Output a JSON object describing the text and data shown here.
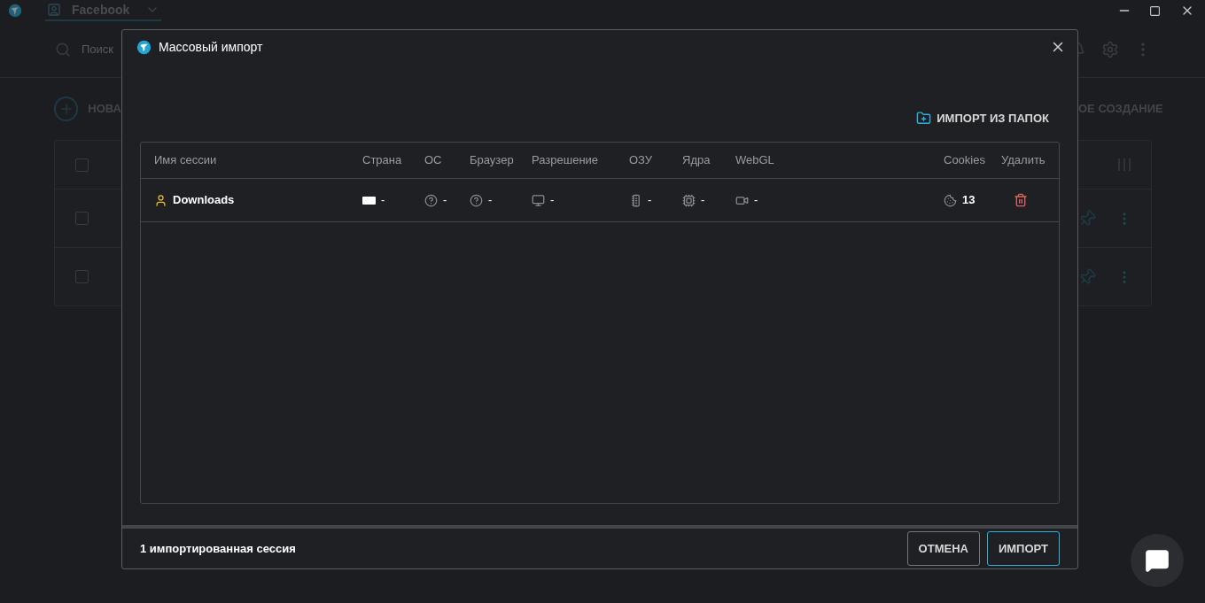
{
  "app": {
    "tab": "Facebook",
    "search_placeholder": "Поиск",
    "new_button": "НОВА",
    "bulk_button": "ОЕ СОЗДАНИЕ",
    "checkboxes": [
      {
        "checked": false
      },
      {
        "checked": false
      },
      {
        "checked": false
      }
    ]
  },
  "dialog": {
    "title": "Массовый импорт",
    "folder_import": "ИМПОРТ ИЗ ПАПОК",
    "columns": [
      "Имя сессии",
      "Страна",
      "ОС",
      "Браузер",
      "Разрешение",
      "ОЗУ",
      "Ядра",
      "WebGL",
      "Cookies",
      "Удалить"
    ],
    "rows": [
      {
        "cells": [
          {
            "kind": "name",
            "text": "Downloads"
          },
          {
            "kind": "country",
            "text": "-"
          },
          {
            "kind": "os",
            "text": "-"
          },
          {
            "kind": "browser",
            "text": "-"
          },
          {
            "kind": "resolution",
            "text": "-"
          },
          {
            "kind": "ram",
            "text": "-"
          },
          {
            "kind": "cores",
            "text": "-"
          },
          {
            "kind": "webgl",
            "text": "-"
          },
          {
            "kind": "cookies",
            "text": "13"
          },
          {
            "kind": "delete"
          }
        ]
      }
    ],
    "summary": "1 импортированная сессия",
    "buttons": [
      {
        "label": "ОТМЕНА",
        "kind": "secondary"
      },
      {
        "label": "ИМПОРТ",
        "kind": "primary"
      }
    ]
  }
}
